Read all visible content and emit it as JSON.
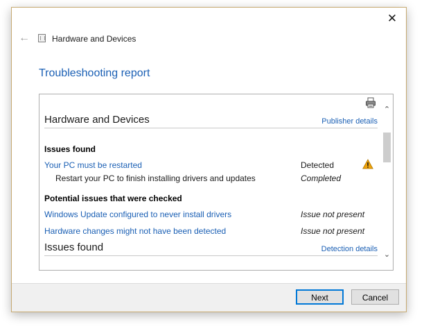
{
  "window": {
    "title": "Hardware and Devices",
    "close_glyph": "✕",
    "back_glyph": "←"
  },
  "report": {
    "heading": "Troubleshooting report",
    "sections": [
      {
        "title": "Hardware and Devices",
        "link": "Publisher details",
        "issues_label": "Issues found",
        "issue": {
          "name": "Your PC must be restarted",
          "status": "Detected",
          "sub": "Restart your PC to finish installing drivers and updates",
          "sub_status": "Completed",
          "icon": "warning-icon"
        },
        "checked_label": "Potential issues that were checked",
        "checked": [
          {
            "name": "Windows Update configured to never install drivers",
            "status": "Issue not present"
          },
          {
            "name": "Hardware changes might not have been detected",
            "status": "Issue not present"
          }
        ]
      },
      {
        "title": "Issues found",
        "link": "Detection details"
      }
    ],
    "scroll": {
      "up": "⌃",
      "down": "⌄",
      "position": 0.15,
      "visible_fraction": 0.23
    }
  },
  "footer": {
    "next_label": "Next",
    "cancel_label": "Cancel"
  },
  "colors": {
    "link": "#1a5fb4",
    "warning": "#f0a30a",
    "primary_border": "#0078d7"
  }
}
